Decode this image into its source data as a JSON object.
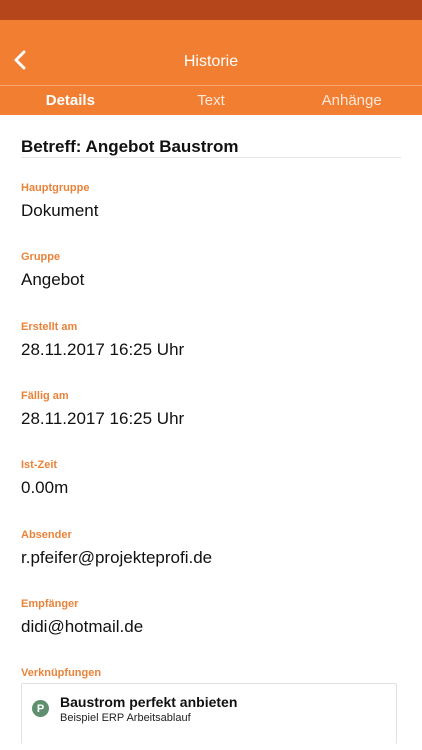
{
  "nav": {
    "title": "Historie",
    "back_icon": "chevron-left-icon"
  },
  "tabs": [
    {
      "label": "Details",
      "active": true
    },
    {
      "label": "Text",
      "active": false
    },
    {
      "label": "Anhänge",
      "active": false
    }
  ],
  "subject": "Betreff: Angebot Baustrom",
  "fields": [
    {
      "label": "Hauptgruppe",
      "value": "Dokument"
    },
    {
      "label": "Gruppe",
      "value": "Angebot"
    },
    {
      "label": "Erstellt am",
      "value": "28.11.2017 16:25 Uhr"
    },
    {
      "label": "Fällig am",
      "value": "28.11.2017 16:25 Uhr"
    },
    {
      "label": "Ist-Zeit",
      "value": "0.00m"
    },
    {
      "label": "Absender",
      "value": "r.pfeifer@projekteprofi.de"
    },
    {
      "label": "Empfänger",
      "value": "didi@hotmail.de"
    }
  ],
  "links": {
    "label": "Verknüpfungen",
    "items": [
      {
        "icon_letter": "P",
        "title": "Baustrom perfekt anbieten",
        "subtitle": "Beispiel ERP Arbeitsablauf"
      }
    ]
  },
  "colors": {
    "status_bar": "#b5461b",
    "nav_bar": "#f27e32",
    "label_orange": "#e8833a",
    "link_icon_bg": "#5f8f6f"
  }
}
